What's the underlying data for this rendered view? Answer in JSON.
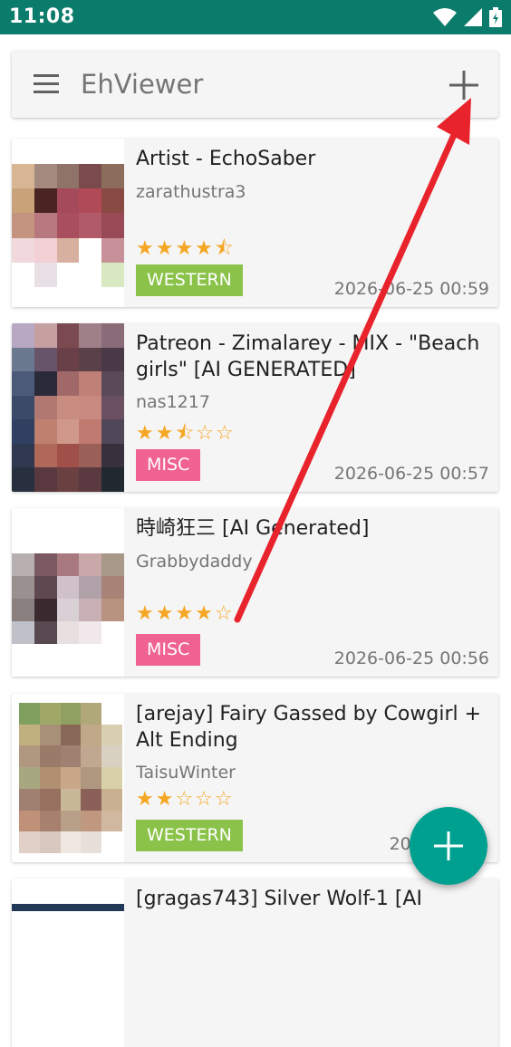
{
  "status_bar": {
    "time": "11:08",
    "icons": [
      "wifi-icon",
      "signal-icon",
      "battery-charging-icon"
    ]
  },
  "toolbar": {
    "title": "EhViewer",
    "menu_icon": "hamburger-menu-icon",
    "add_icon": "plus-icon"
  },
  "colors": {
    "western": "#8bc34a",
    "misc": "#f06292",
    "status_bar": "#0b7c6b",
    "fab": "#00a090",
    "star": "#f5a623",
    "annotation_arrow": "#e8232c"
  },
  "gallery": [
    {
      "title": "Artist - EchoSaber",
      "uploader": "zarathustra3",
      "rating": 4.5,
      "stars": "★★★★⯪",
      "category": "WESTERN",
      "category_color": "#8bc34a",
      "date": "2026-06-25 00:59"
    },
    {
      "title": "Patreon - Zimalarey - MIX - \"Beach girls\" [AI GENERATED]",
      "uploader": "nas1217",
      "rating": 2.5,
      "stars": "★★⯪☆☆",
      "category": "MISC",
      "category_color": "#f06292",
      "date": "2026-06-25 00:57"
    },
    {
      "title": "時崎狂三 [AI Generated]",
      "uploader": "Grabbydaddy",
      "rating": 4,
      "stars": "★★★★☆",
      "category": "MISC",
      "category_color": "#f06292",
      "date": "2026-06-25 00:56"
    },
    {
      "title": "[arejay] Fairy Gassed by Cowgirl + Alt Ending",
      "uploader": "TaisuWinter",
      "rating": 2,
      "stars": "★★☆☆☆",
      "category": "WESTERN",
      "category_color": "#8bc34a",
      "date": "2026-06-25"
    },
    {
      "title": "[gragas743] Silver Wolf-1 [AI"
    }
  ],
  "fab": {
    "icon": "plus-icon"
  }
}
